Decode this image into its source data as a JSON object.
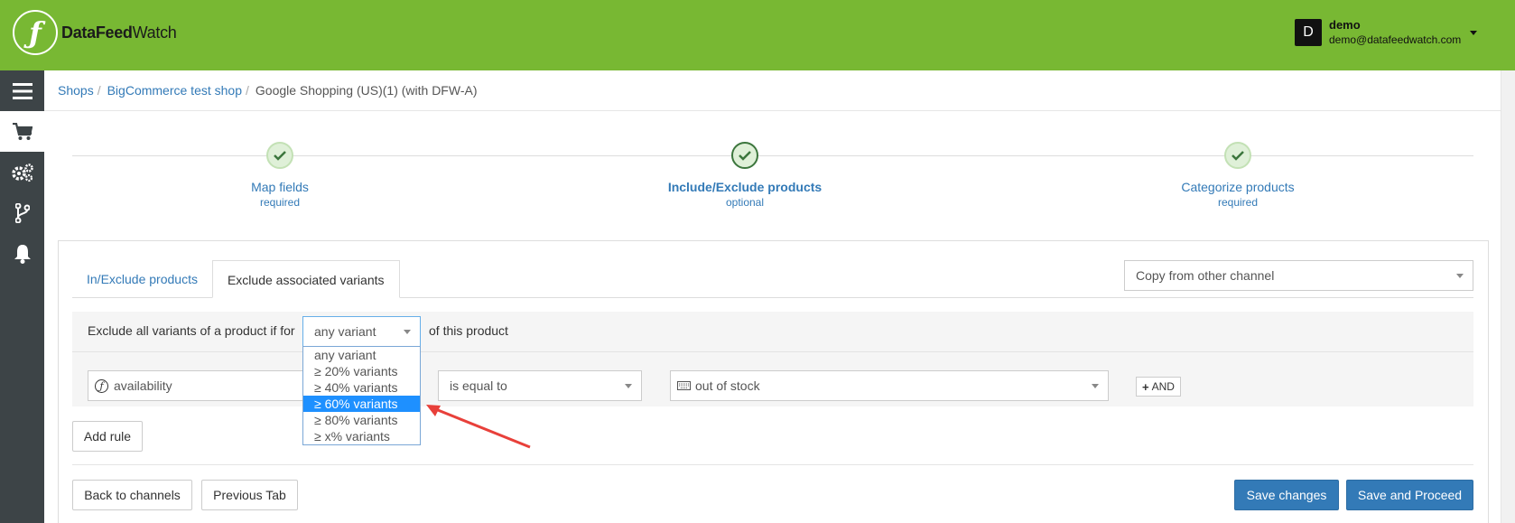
{
  "header": {
    "logo_icon": "ƒ",
    "logo_bold": "DataFeed",
    "logo_light": "Watch",
    "user_initial": "D",
    "user_name": "demo",
    "user_email": "demo@datafeedwatch.com"
  },
  "sidebar": {
    "items": [
      {
        "icon": "menu-icon"
      },
      {
        "icon": "cart-icon",
        "active": true
      },
      {
        "icon": "gears-icon"
      },
      {
        "icon": "branch-icon"
      },
      {
        "icon": "bell-icon"
      }
    ]
  },
  "breadcrumb": {
    "items": [
      "Shops",
      "BigCommerce test shop"
    ],
    "current": "Google Shopping (US)(1) (with DFW-A)",
    "separator": "/"
  },
  "steps": [
    {
      "title": "Map fields",
      "sub": "required"
    },
    {
      "title": "Include/Exclude products",
      "sub": "optional"
    },
    {
      "title": "Categorize products",
      "sub": "required"
    }
  ],
  "tabs": {
    "inactive": "In/Exclude products",
    "active": "Exclude associated variants"
  },
  "copy_select": {
    "value": "Copy from other channel"
  },
  "rule_header": {
    "prefix": "Exclude all variants of a product if for",
    "selected": "any variant",
    "suffix": "of this product"
  },
  "dropdown": {
    "options": [
      "any variant",
      "≥ 20% variants",
      "≥ 40% variants",
      "≥ 60% variants",
      "≥ 80% variants",
      "≥ x% variants"
    ],
    "highlighted": 3
  },
  "rule": {
    "field": "availability",
    "operator": "is equal to",
    "value": "out of stock",
    "and_label": "AND"
  },
  "buttons": {
    "add_rule": "Add rule",
    "back": "Back to channels",
    "previous": "Previous Tab",
    "save": "Save changes",
    "save_proceed": "Save and Proceed"
  },
  "colors": {
    "header": "#78b833",
    "sidebar": "#3d4447",
    "link": "#337ab7",
    "primary": "#337ab7",
    "highlight": "#1e90ff",
    "arrow": "#e8403a"
  }
}
